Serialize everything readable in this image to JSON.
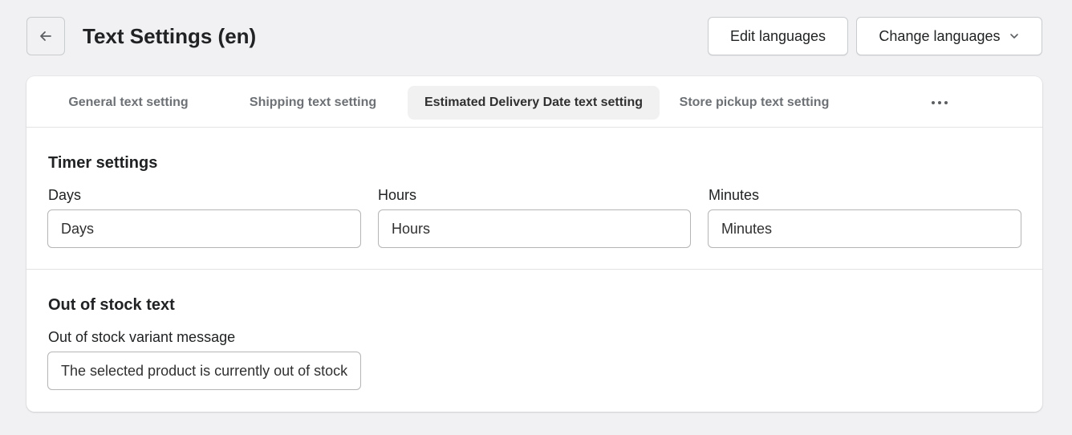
{
  "header": {
    "back_icon": "arrow-left-icon",
    "title": "Text Settings (en)",
    "edit_languages_label": "Edit languages",
    "change_languages_label": "Change languages",
    "change_languages_icon": "chevron-down-icon"
  },
  "tabs": [
    {
      "label": "General text setting",
      "active": false
    },
    {
      "label": "Shipping text setting",
      "active": false
    },
    {
      "label": "Estimated Delivery Date text setting",
      "active": true
    },
    {
      "label": "Store pickup text setting",
      "active": false
    }
  ],
  "more_tabs_icon": "ellipsis-horizontal-icon",
  "timer_settings": {
    "title": "Timer settings",
    "fields": [
      {
        "label": "Days",
        "value": "Days"
      },
      {
        "label": "Hours",
        "value": "Hours"
      },
      {
        "label": "Minutes",
        "value": "Minutes"
      }
    ]
  },
  "out_of_stock": {
    "title": "Out of stock text",
    "field": {
      "label": "Out of stock variant message",
      "value": "The selected product is currently out of stock"
    }
  }
}
